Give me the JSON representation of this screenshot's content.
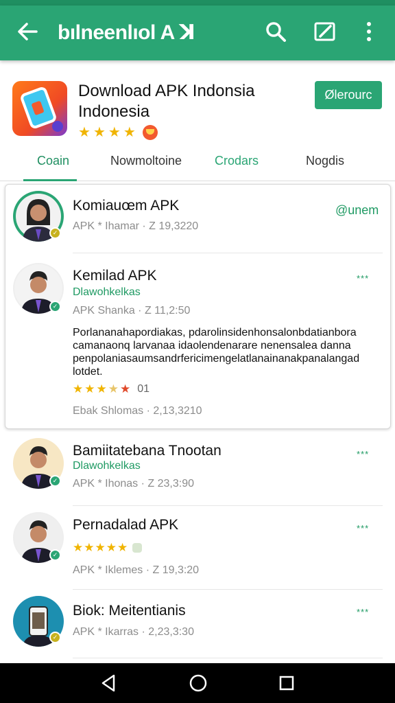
{
  "appbar": {
    "title": "bılneenlıol A ꓘ",
    "back_icon": "arrow-left-icon",
    "search_icon": "search-icon",
    "edit_icon": "edit-icon",
    "more_icon": "more-vert-icon"
  },
  "colors": {
    "primary": "#2aa574",
    "primary_dark": "#1f8f61",
    "star": "#f0b400"
  },
  "app": {
    "name": "Download APK Indonsia Indonesia",
    "install_label": "Ølerourc",
    "rating_stars": 4
  },
  "tabs": [
    {
      "label": "Coain"
    },
    {
      "label": "Nowmoltoine"
    },
    {
      "label": "Crodars"
    },
    {
      "label": "Nogdis"
    }
  ],
  "items": [
    {
      "title": "Komiauœm APK",
      "meta": "APK * Ihamar  ·   Z 19,3220",
      "side": "@unem"
    },
    {
      "title": "Kemilad APK",
      "sub": "Dlawohkelkas",
      "meta": "APK Shanka  ·   Z 11,2:50",
      "body": "Porlananahapordiakas, pdarolinsidenhonsalonbdatianbora camanaonq larvanaa idaolendenarare nenensalea danna penpolaniasaumsandrfericimengelatlanainanakpanalangad lotdet.",
      "rating_stars": 3,
      "rating_count": "01",
      "meta2": "Ebak Shlomas  ·   2,13,3210",
      "side": "***"
    },
    {
      "title": "Bamiitatebana Tnootan",
      "sub": "Dlawohkelkas",
      "meta": "APK * Ihonas  ·   Z 23,3:90",
      "side": "***"
    },
    {
      "title": "Pernadalad APK",
      "rating_stars": 5,
      "meta": "APK * Iklemes  ·   Z 19,3:20",
      "side": "***"
    },
    {
      "title": "Biok: Meitentianis",
      "meta": "APK * Ikarras  ·   2,23,3:30",
      "side": "***"
    }
  ],
  "navbar": {
    "back_icon": "nav-back-icon",
    "home_icon": "nav-home-icon",
    "recents_icon": "nav-recents-icon"
  }
}
